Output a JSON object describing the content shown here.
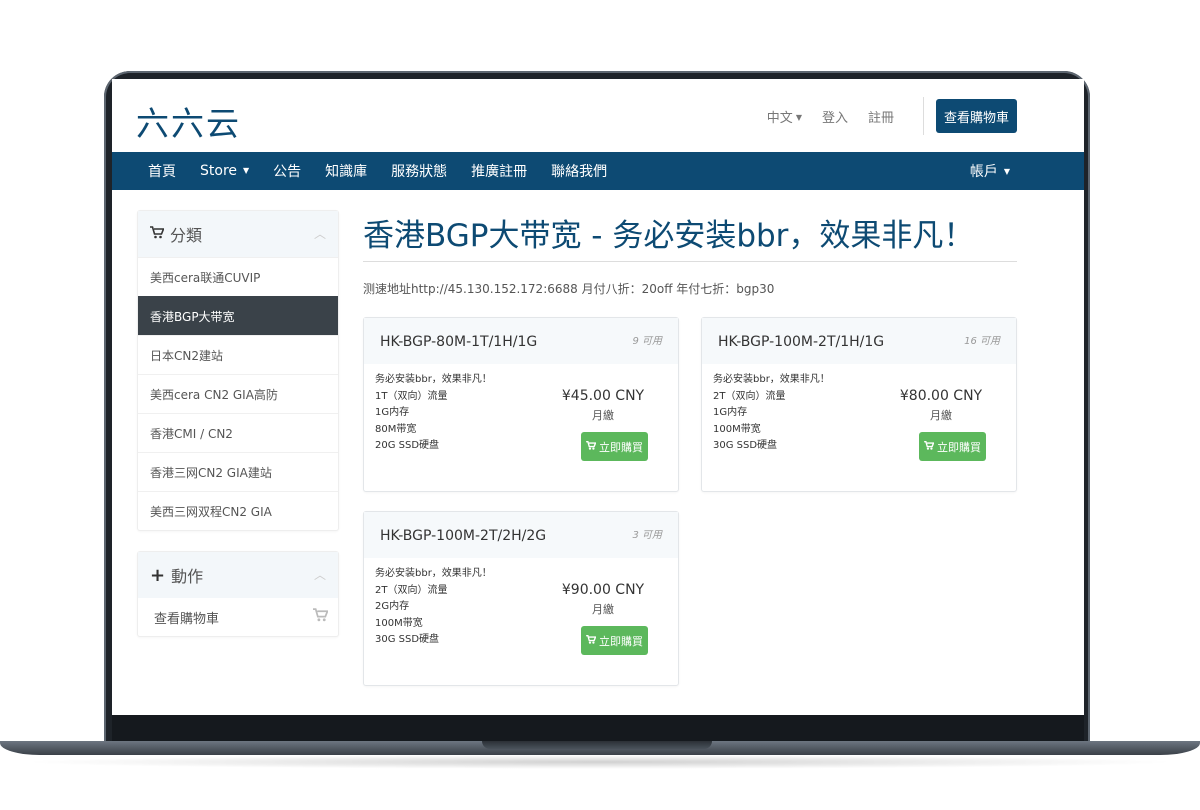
{
  "header": {
    "logo": "六六云",
    "language": "中文",
    "login": "登入",
    "register": "註冊",
    "view_cart": "查看購物車"
  },
  "nav": {
    "items": [
      "首頁",
      "Store",
      "公告",
      "知識庫",
      "服務狀態",
      "推廣註冊",
      "聯絡我們"
    ],
    "account": "帳戶"
  },
  "sidebar": {
    "categories_title": "分類",
    "categories": [
      "美西cera联通CUVIP",
      "香港BGP大带宽",
      "日本CN2建站",
      "美西cera CN2 GIA高防",
      "香港CMI / CN2",
      "香港三网CN2 GIA建站",
      "美西三网双程CN2 GIA"
    ],
    "active_index": 1,
    "actions_title": "動作",
    "actions": [
      "查看購物車"
    ]
  },
  "main": {
    "title": "香港BGP大带宽 - 务必安装bbr，效果非凡！",
    "subtitle": "测速地址http://45.130.152.172:6688 月付八折：20off 年付七折：bgp30",
    "products": [
      {
        "name": "HK-BGP-80M-1T/1H/1G",
        "stock": "9 可用",
        "desc": [
          "务必安装bbr，效果非凡！",
          "1T（双向）流量",
          "1G内存",
          "80M带宽",
          "20G SSD硬盘"
        ],
        "price": "¥45.00 CNY",
        "cycle": "月繳",
        "buy": "立即購買"
      },
      {
        "name": "HK-BGP-100M-2T/1H/1G",
        "stock": "16 可用",
        "desc": [
          "务必安装bbr，效果非凡！",
          "2T（双向）流量",
          "1G内存",
          "100M带宽",
          "30G SSD硬盘"
        ],
        "price": "¥80.00 CNY",
        "cycle": "月繳",
        "buy": "立即購買"
      },
      {
        "name": "HK-BGP-100M-2T/2H/2G",
        "stock": "3 可用",
        "desc": [
          "务必安装bbr，效果非凡！",
          "2T（双向）流量",
          "2G内存",
          "100M带宽",
          "30G SSD硬盘"
        ],
        "price": "¥90.00 CNY",
        "cycle": "月繳",
        "buy": "立即購買"
      }
    ]
  },
  "colors": {
    "brand": "#0d4a73",
    "buy": "#5cb85c",
    "active_category": "#3a4249"
  }
}
